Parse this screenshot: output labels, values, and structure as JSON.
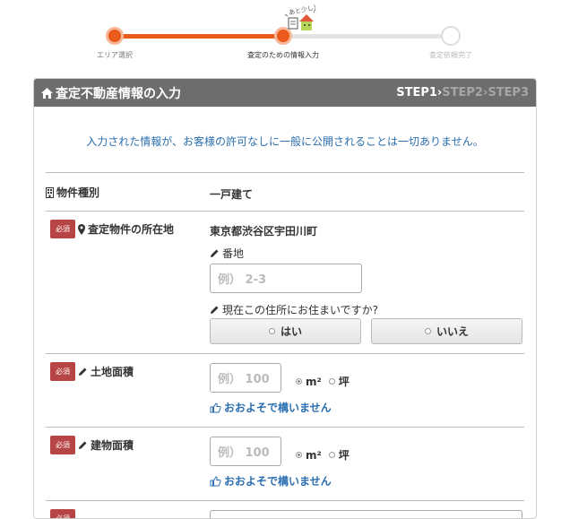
{
  "progress": {
    "steps": [
      "エリア選択",
      "査定のための情報入力",
      "査定依頼完了"
    ],
    "current_step": 2,
    "mascot_text": "あと少し！"
  },
  "panel": {
    "title": "査定不動産情報の入力",
    "step1": "STEP1",
    "step2": "STEP2",
    "step3": "STEP3",
    "sep": "›"
  },
  "notice": "入力された情報が、お客様の許可なしに一般に公開されることは一切ありません。",
  "property_type": {
    "label": "物件種別",
    "value": "一戸建て"
  },
  "location": {
    "required": "必須",
    "label": "査定物件の所在地",
    "address": "東京都渋谷区宇田川町",
    "lot_label": "番地",
    "lot_placeholder": "例） 2-3",
    "residence_question": "現在この住所にお住まいですか?",
    "yes": "はい",
    "no": "いいえ"
  },
  "land_area": {
    "required": "必須",
    "label": "土地面積",
    "placeholder": "例） 100",
    "unit_m2": "m²",
    "unit_tsubo": "坪",
    "approx": "おおよそで構いません"
  },
  "building_area": {
    "required": "必須",
    "label": "建物面積",
    "placeholder": "例） 100",
    "unit_m2": "m²",
    "unit_tsubo": "坪",
    "approx": "おおよそで構いません"
  },
  "next_row": {
    "required": "必須"
  },
  "colors": {
    "accent": "#ea5a1a",
    "link": "#2b6fb0",
    "required": "#b84545",
    "header": "#6d6d6d"
  }
}
